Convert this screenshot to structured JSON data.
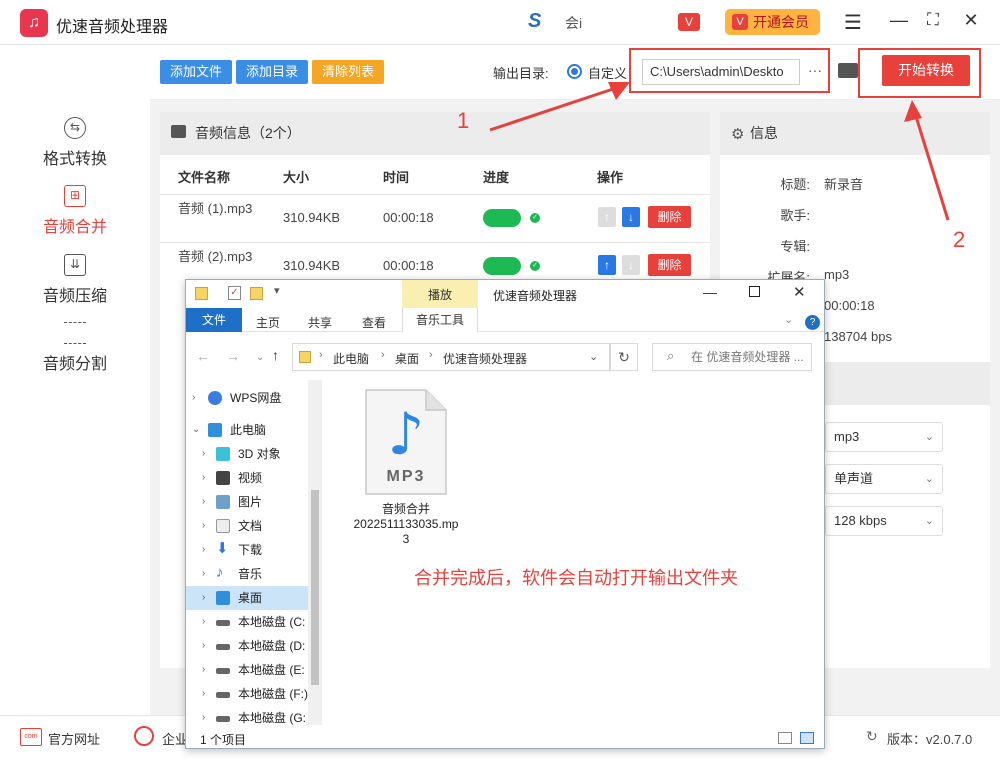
{
  "app": {
    "title": "优速音频处理器",
    "vip_label": "开通会员",
    "center_text": "会i"
  },
  "sidebar": {
    "items": [
      {
        "label": "格式转换",
        "icon": "format-convert-icon"
      },
      {
        "label": "音频合并",
        "icon": "audio-merge-icon"
      },
      {
        "label": "音频压缩",
        "icon": "audio-compress-icon"
      },
      {
        "label": "音频分割",
        "icon": "audio-split-icon"
      }
    ]
  },
  "toolbar": {
    "add_file": "添加文件",
    "add_dir": "添加目录",
    "clear_list": "清除列表",
    "output_label": "输出目录:",
    "custom_label": "自定义",
    "output_path": "C:\\Users\\admin\\Deskto",
    "more": "···",
    "start": "开始转换"
  },
  "file_panel": {
    "title": "音频信息（2个）",
    "columns": [
      "文件名称",
      "大小",
      "时间",
      "进度",
      "操作"
    ],
    "rows": [
      {
        "name": "音频 (1).mp3",
        "size": "310.94KB",
        "time": "00:00:18",
        "delete": "删除"
      },
      {
        "name": "音频 (2).mp3",
        "size": "310.94KB",
        "time": "00:00:18",
        "delete": "删除"
      }
    ]
  },
  "info_panel": {
    "title": "信息",
    "fields": [
      {
        "k": "标题:",
        "v": "新录音"
      },
      {
        "k": "歌手:",
        "v": ""
      },
      {
        "k": "专辑:",
        "v": ""
      },
      {
        "k": "扩展名:",
        "v": "mp3"
      },
      {
        "k": "",
        "v": "00:00:18"
      },
      {
        "k": "",
        "v": "138704 bps"
      }
    ],
    "selects": [
      "mp3",
      "单声道",
      "128 kbps"
    ]
  },
  "annotations": {
    "num1": "1",
    "num2": "2",
    "note": "合并完成后，软件会自动打开输出文件夹"
  },
  "footer": {
    "website": "官方网址",
    "enterprise": "企业",
    "version": "版本：v2.0.7.0"
  },
  "explorer": {
    "context_tab": "播放",
    "window_title": "优速音频处理器",
    "tabs": [
      "文件",
      "主页",
      "共享",
      "查看",
      "音乐工具"
    ],
    "breadcrumb": [
      "此电脑",
      "桌面",
      "优速音频处理器"
    ],
    "search_placeholder": "在 优速音频处理器 ...",
    "tree": [
      {
        "label": "WPS网盘",
        "icon": "cloud-icon"
      },
      {
        "label": "此电脑",
        "icon": "computer-icon"
      },
      {
        "label": "3D 对象",
        "icon": "3d-objects-icon"
      },
      {
        "label": "视频",
        "icon": "video-icon"
      },
      {
        "label": "图片",
        "icon": "pictures-icon"
      },
      {
        "label": "文档",
        "icon": "documents-icon"
      },
      {
        "label": "下载",
        "icon": "download-icon"
      },
      {
        "label": "音乐",
        "icon": "music-icon"
      },
      {
        "label": "桌面",
        "icon": "desktop-icon"
      },
      {
        "label": "本地磁盘 (C:",
        "icon": "disk-icon"
      },
      {
        "label": "本地磁盘 (D:",
        "icon": "disk-icon"
      },
      {
        "label": "本地磁盘 (E:",
        "icon": "disk-icon"
      },
      {
        "label": "本地磁盘 (F:)",
        "icon": "disk-icon"
      },
      {
        "label": "本地磁盘 (G:",
        "icon": "disk-icon"
      }
    ],
    "file": {
      "badge": "MP3",
      "name_line1": "音频合并",
      "name_line2": "2022511133035.mp",
      "name_line3": "3"
    },
    "status": "1 个项目"
  }
}
